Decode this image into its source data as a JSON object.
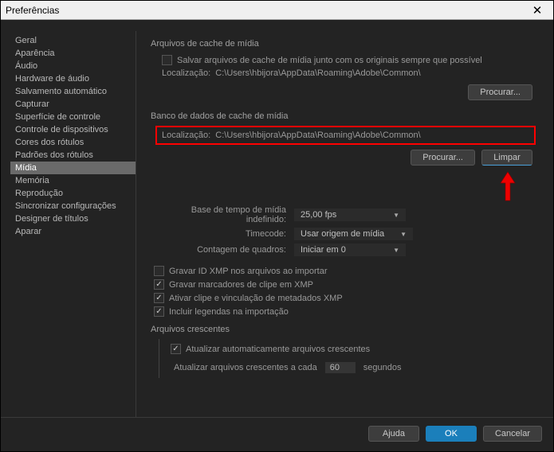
{
  "window": {
    "title": "Preferências"
  },
  "sidebar": {
    "items": [
      {
        "label": "Geral"
      },
      {
        "label": "Aparência"
      },
      {
        "label": "Áudio"
      },
      {
        "label": "Hardware de áudio"
      },
      {
        "label": "Salvamento automático"
      },
      {
        "label": "Capturar"
      },
      {
        "label": "Superfície de controle"
      },
      {
        "label": "Controle de dispositivos"
      },
      {
        "label": "Cores dos rótulos"
      },
      {
        "label": "Padrões dos rótulos"
      },
      {
        "label": "Mídia"
      },
      {
        "label": "Memória"
      },
      {
        "label": "Reprodução"
      },
      {
        "label": "Sincronizar configurações"
      },
      {
        "label": "Designer de títulos"
      },
      {
        "label": "Aparar"
      }
    ],
    "selected": "Mídia"
  },
  "cache": {
    "group": "Arquivos de cache de mídia",
    "save_cb": "Salvar arquivos de cache de mídia junto com os originais sempre que possível",
    "loc_label": "Localização:",
    "loc_value": "C:\\Users\\hbijora\\AppData\\Roaming\\Adobe\\Common\\",
    "browse": "Procurar..."
  },
  "db": {
    "group": "Banco de dados de cache de mídia",
    "loc_label": "Localização:",
    "loc_value": "C:\\Users\\hbijora\\AppData\\Roaming\\Adobe\\Common\\",
    "browse": "Procurar...",
    "clear": "Limpar"
  },
  "timebase": {
    "label": "Base de tempo de mídia indefinido:",
    "value": "25,00 fps"
  },
  "timecode": {
    "label": "Timecode:",
    "value": "Usar origem de mídia"
  },
  "framecount": {
    "label": "Contagem de quadros:",
    "value": "Iniciar em 0"
  },
  "opts": {
    "xmp_id": "Gravar ID XMP nos arquivos ao importar",
    "clip_markers": "Gravar marcadores de clipe em XMP",
    "enable_clip": "Ativar clipe e vinculação de metadados XMP",
    "captions": "Incluir legendas na importação"
  },
  "growing": {
    "group": "Arquivos crescentes",
    "auto": "Atualizar automaticamente arquivos crescentes",
    "each_pre": "Atualizar arquivos crescentes a cada",
    "value": "60",
    "each_post": "segundos"
  },
  "footer": {
    "help": "Ajuda",
    "ok": "OK",
    "cancel": "Cancelar"
  }
}
